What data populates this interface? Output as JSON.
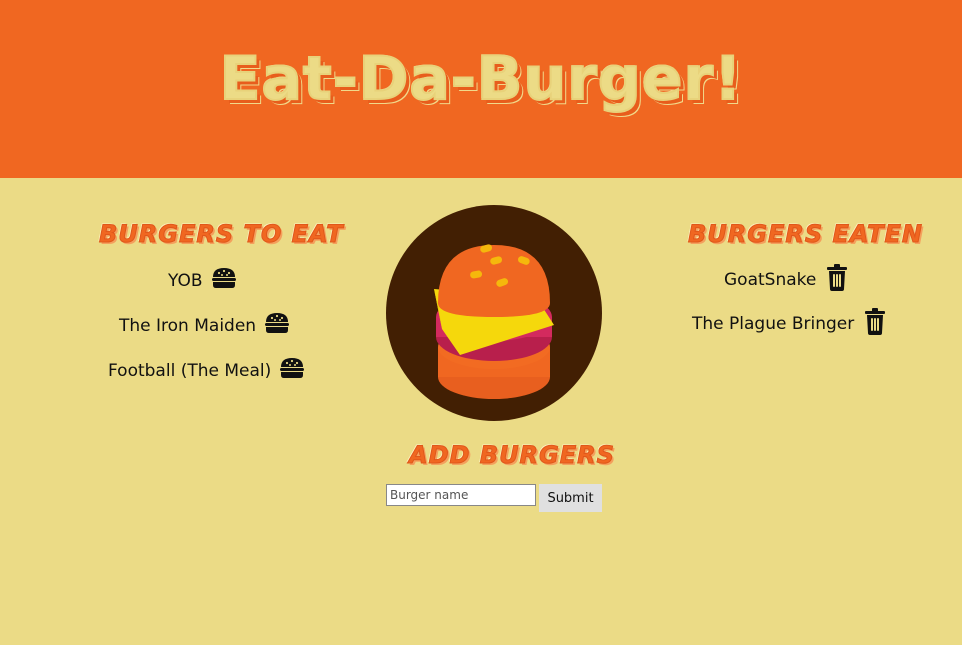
{
  "header": {
    "title": "Eat-Da-Burger!"
  },
  "to_eat": {
    "heading": "Burgers To Eat",
    "items": [
      {
        "name": "YOB",
        "icon": "burger-icon"
      },
      {
        "name": "The Iron Maiden",
        "icon": "burger-icon"
      },
      {
        "name": "Football (The Meal)",
        "icon": "burger-icon"
      }
    ]
  },
  "eaten": {
    "heading": "Burgers Eaten",
    "items": [
      {
        "name": "GoatSnake",
        "icon": "trash-icon"
      },
      {
        "name": "The Plague Bringer",
        "icon": "trash-icon"
      }
    ]
  },
  "add_form": {
    "heading": "Add Burgers",
    "input_placeholder": "Burger name",
    "input_value": "",
    "submit_label": "Submit"
  },
  "colors": {
    "header_bg": "#f06721",
    "page_bg": "#ebdb86",
    "title_fill": "#ecdb86",
    "heading_fill": "#f06721",
    "circle_bg": "#421f03",
    "bun": "#f06721",
    "cheese": "#f5d80c",
    "patty": "#d32a5e",
    "seeds": "#f5b80c"
  }
}
